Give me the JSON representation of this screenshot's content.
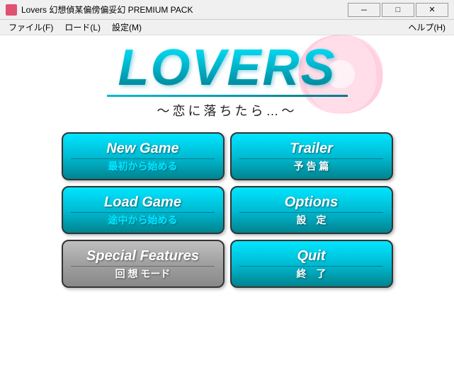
{
  "titlebar": {
    "title": "Lovers 幻想偵某偏傍偏妥幻 PREMIUM PACK",
    "icon_label": "app-icon",
    "minimize": "－",
    "maximize": "□",
    "close": "✕"
  },
  "menubar": {
    "items": [
      {
        "label": "ファイル(F)"
      },
      {
        "label": "ロード(L)"
      },
      {
        "label": "設定(M)"
      }
    ],
    "help": "ヘルプ(H)"
  },
  "logo": {
    "text": "LOVERS",
    "subtitle": "～恋に落ちたら…～"
  },
  "buttons": [
    {
      "id": "new-game",
      "top": "New Game",
      "bottom": "最初から始める",
      "disabled": false,
      "bottom_cyan": true
    },
    {
      "id": "trailer",
      "top": "Trailer",
      "bottom": "予 告 篇",
      "disabled": false,
      "bottom_cyan": false
    },
    {
      "id": "load-game",
      "top": "Load Game",
      "bottom": "途中から始める",
      "disabled": false,
      "bottom_cyan": true
    },
    {
      "id": "options",
      "top": "Options",
      "bottom": "設　定",
      "disabled": false,
      "bottom_cyan": false
    },
    {
      "id": "special-features",
      "top": "Special Features",
      "bottom": "回 想 モード",
      "disabled": true,
      "bottom_cyan": false
    },
    {
      "id": "quit",
      "top": "Quit",
      "bottom": "終　了",
      "disabled": false,
      "bottom_cyan": false
    }
  ]
}
